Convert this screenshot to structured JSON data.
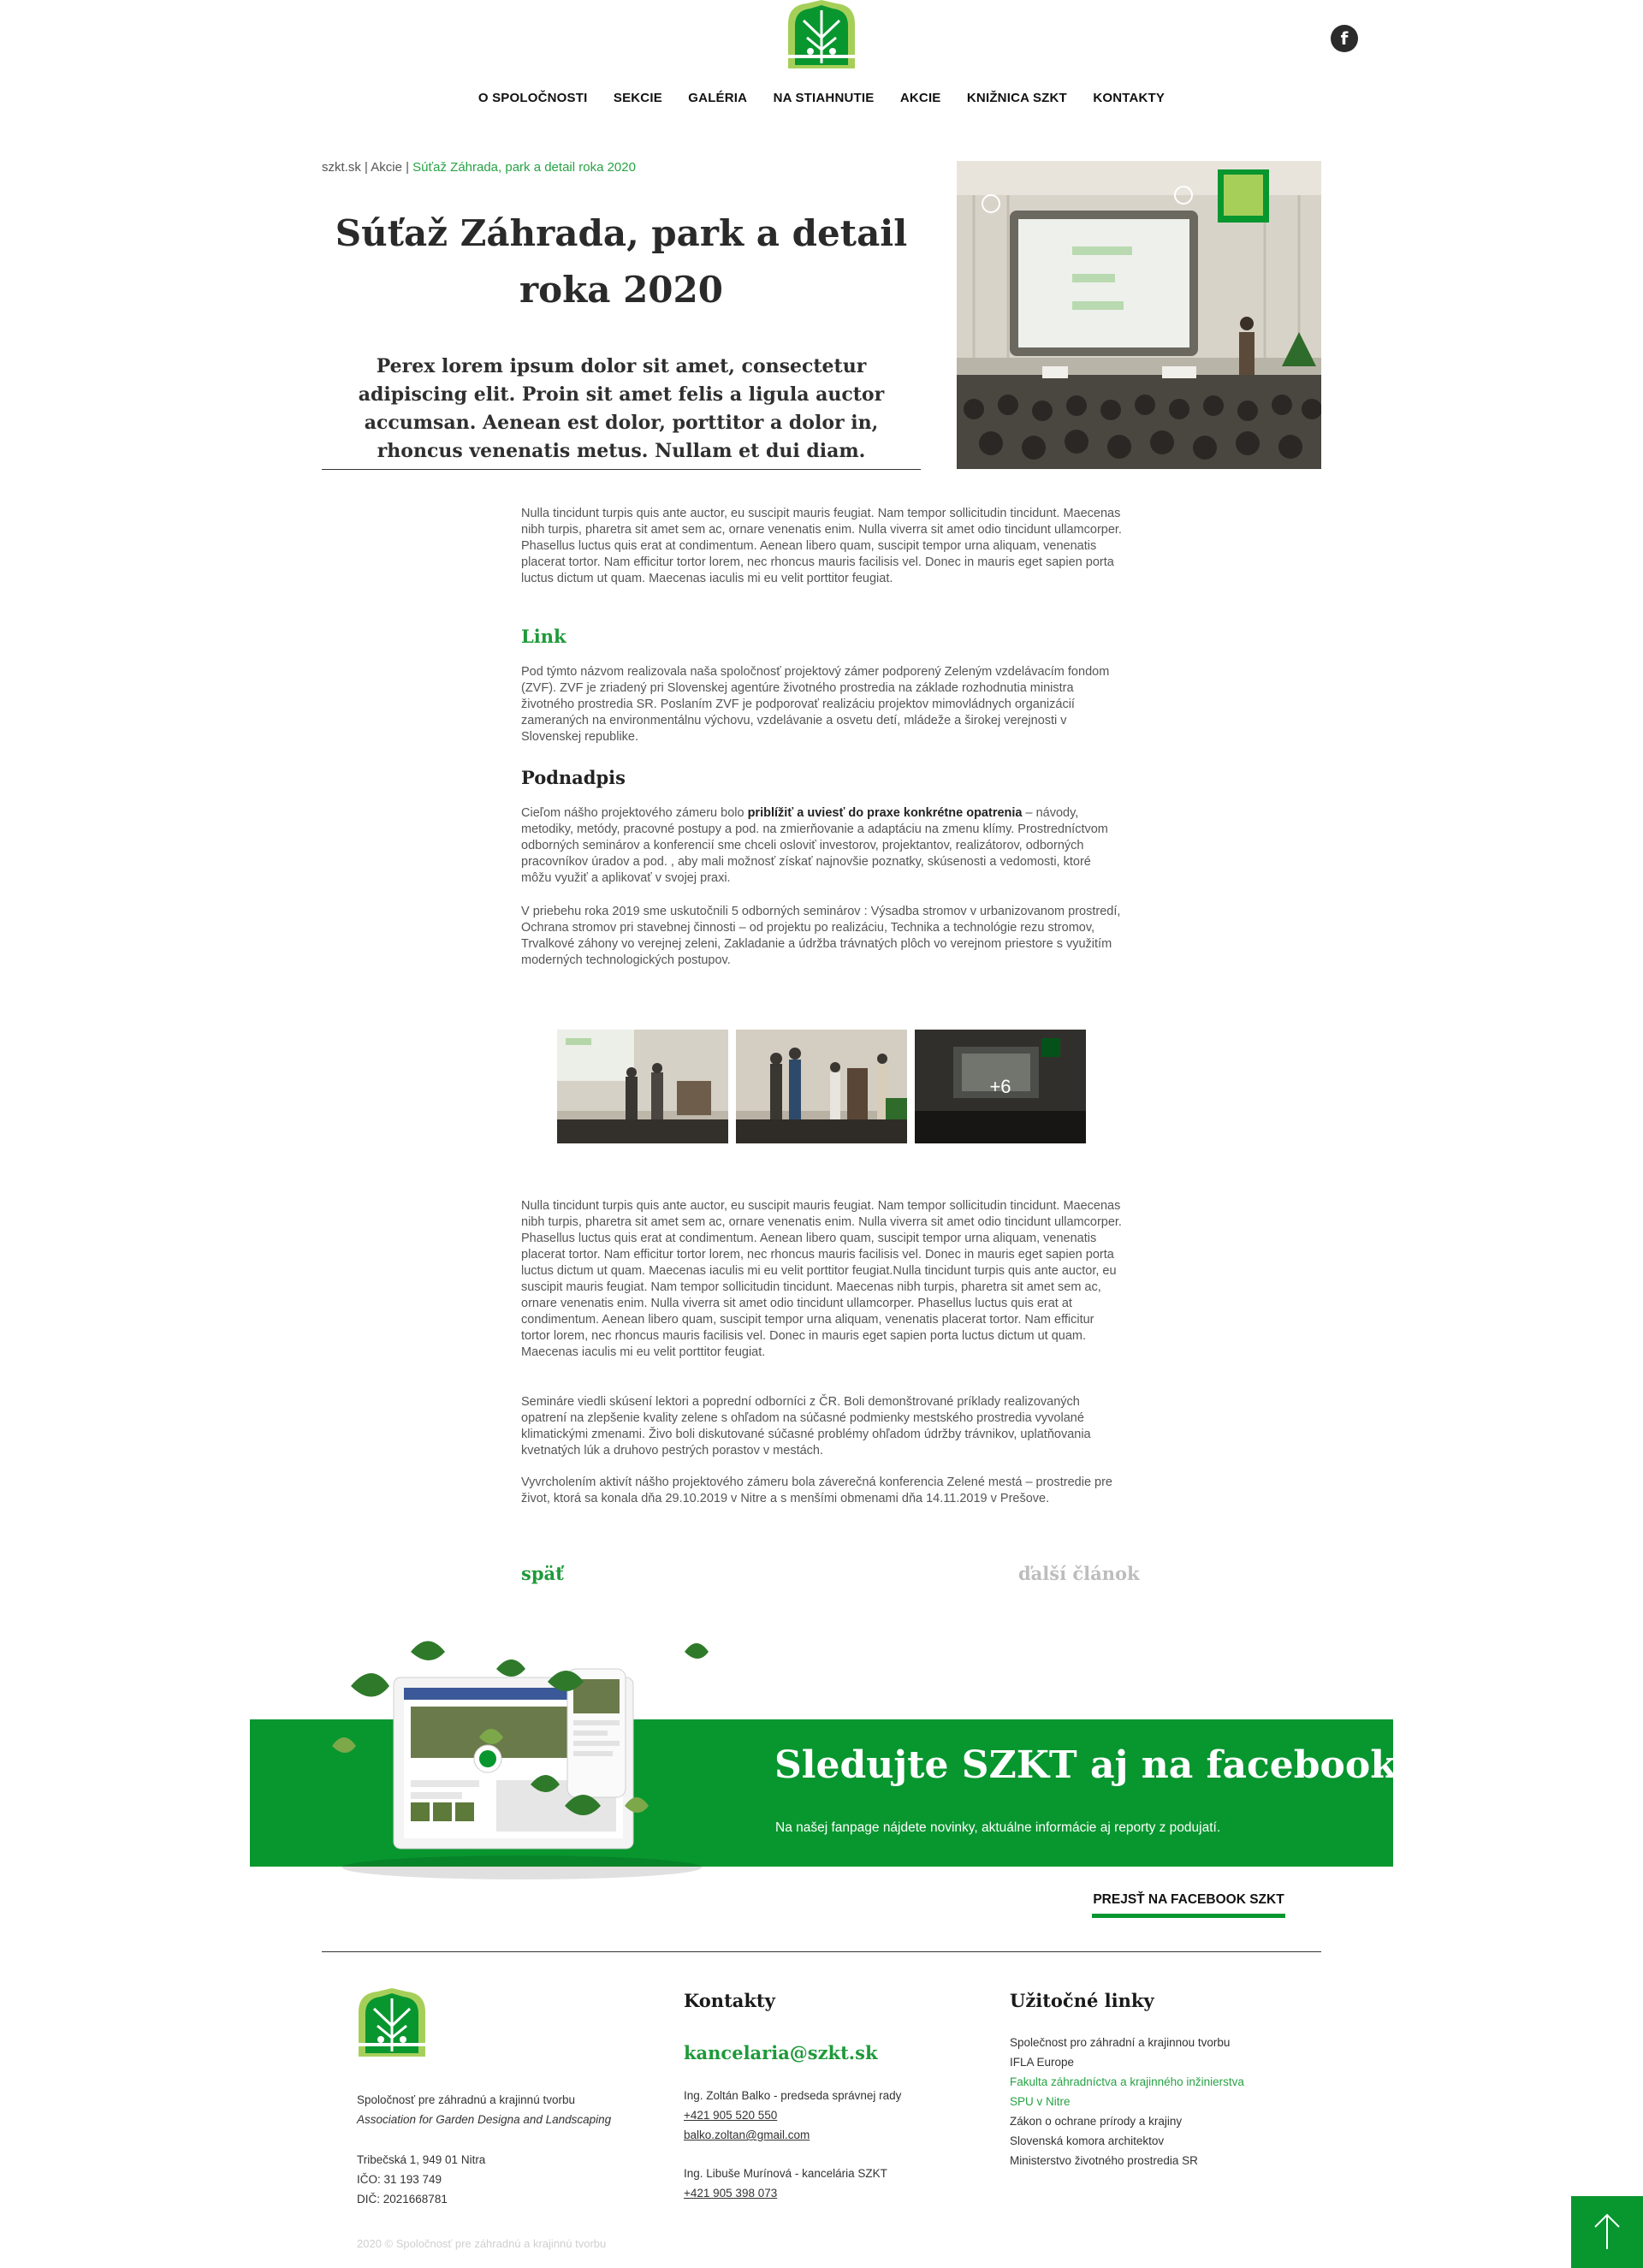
{
  "header": {
    "facebook_glyph": "f",
    "nav": [
      "O SPOLOČNOSTI",
      "SEKCIE",
      "GALÉRIA",
      "NA STIAHNUTIE",
      "AKCIE",
      "KNIŽNICA SZKT",
      "KONTAKTY"
    ]
  },
  "breadcrumb": {
    "home": "szkt.sk",
    "sep1": " | ",
    "section": "Akcie",
    "sep2": " | ",
    "current": "Súťaž Záhrada, park a detail roka 2020"
  },
  "article": {
    "title_line1": "Súťaž Záhrada, park a detail",
    "title_line2": "roka 2020",
    "perex": "Perex lorem ipsum dolor sit amet, consectetur adipiscing elit. Proin sit amet felis a ligula auctor accumsan. Aenean est dolor, porttitor a dolor in, rhoncus venenatis metus. Nullam et dui diam.",
    "p1": "Nulla tincidunt turpis quis ante auctor, eu suscipit mauris feugiat. Nam tempor sollicitudin tincidunt. Maecenas nibh turpis, pharetra sit amet sem ac, ornare venenatis enim. Nulla viverra sit amet odio tincidunt ullamcorper. Phasellus luctus quis erat at condimentum. Aenean libero quam, suscipit tempor urna aliquam, venenatis placerat tortor. Nam efficitur tortor lorem, nec rhoncus mauris facilisis vel. Donec in mauris eget sapien porta luctus dictum ut quam. Maecenas iaculis mi eu velit porttitor feugiat.",
    "link_heading": "Link",
    "p2": "Pod týmto názvom realizovala naša spoločnosť projektový zámer podporený Zeleným vzdelávacím fondom (ZVF). ZVF je zriadený pri Slovenskej agentúre životného prostredia na základe rozhodnutia ministra životného prostredia SR. Poslaním ZVF je podporovať realizáciu projektov mimovládnych organizácií zameraných na environmentálnu výchovu, vzdelávanie a osvetu detí, mládeže a širokej verejnosti v Slovenskej republike.",
    "subheading": "Podnadpis",
    "p3_before": "Cieľom nášho projektového zámeru bolo ",
    "p3_bold": "priblížiť a uviesť do praxe konkrétne opatrenia",
    "p3_after": " – návody, metodiky, metódy, pracovné postupy a pod. na zmierňovanie a adaptáciu na zmenu klímy. Prostredníctvom odborných seminárov a konferencií sme chceli osloviť investorov, projektantov, realizátorov, odborných pracovníkov úradov a pod. , aby mali možnosť získať najnovšie poznatky, skúsenosti a vedomosti, ktoré môžu využiť a aplikovať v svojej praxi.",
    "p4": "V priebehu roka 2019 sme uskutočnili 5 odborných seminárov : Výsadba stromov v urbanizovanom prostredí, Ochrana stromov pri stavebnej činnosti – od projektu po realizáciu, Technika a technológie rezu stromov, Trvalkové záhony vo verejnej zeleni, Zakladanie a údržba trávnatých plôch vo verejnom priestore s využitím moderných technologických postupov.",
    "gallery_more": "+6",
    "p5": "Nulla tincidunt turpis quis ante auctor, eu suscipit mauris feugiat. Nam tempor sollicitudin tincidunt. Maecenas nibh turpis, pharetra sit amet sem ac, ornare venenatis enim. Nulla viverra sit amet odio tincidunt ullamcorper. Phasellus luctus quis erat at condimentum. Aenean libero quam, suscipit tempor urna aliquam, venenatis placerat tortor. Nam efficitur tortor lorem, nec rhoncus mauris facilisis vel. Donec in mauris eget sapien porta luctus dictum ut quam. Maecenas iaculis mi eu velit porttitor feugiat.Nulla tincidunt turpis quis ante auctor, eu suscipit mauris feugiat. Nam tempor sollicitudin tincidunt. Maecenas nibh turpis, pharetra sit amet sem ac, ornare venenatis enim. Nulla viverra sit amet odio tincidunt ullamcorper. Phasellus luctus quis erat at condimentum. Aenean libero quam, suscipit tempor urna aliquam, venenatis placerat tortor. Nam efficitur tortor lorem, nec rhoncus mauris facilisis vel. Donec in mauris eget sapien porta luctus dictum ut quam. Maecenas iaculis mi eu velit porttitor feugiat.",
    "p6": "Semináre viedli skúsení lektori a poprední odborníci z ČR. Boli demonštrované príklady realizovaných opatrení na zlepšenie kvality zelene s ohľadom na súčasné podmienky mestského prostredia vyvolané klimatickými zmenami. Živo boli diskutované súčasné problémy ohľadom údržby trávnikov, uplatňovania kvetnatých lúk a druhovo pestrých porastov v mestách.",
    "p7": "Vyvrcholením aktivít nášho projektového zámeru bola záverečná konferencia Zelené mestá – prostredie pre život, ktorá sa konala dňa 29.10.2019 v Nitre a s menšími obmenami dňa 14.11.2019 v Prešove.",
    "back": "späť",
    "next": "ďalší článok"
  },
  "facebook_banner": {
    "heading": "Sledujte SZKT aj na facebooku",
    "subtext": "Na našej fanpage nájdete novinky, aktuálne informácie aj reporty z podujatí.",
    "button": "PREJSŤ NA FACEBOOK SZKT"
  },
  "footer": {
    "company_name": "Spoločnosť pre záhradnú a krajinnú tvorbu",
    "company_en": "Association for Garden Designa and Landscaping",
    "address": "Tribečská 1,  949 01 Nitra",
    "ico": "IČO: 31 193 749",
    "dic": "DIČ: 2021668781",
    "copyright": "2020 © Spoločnosť pre záhradnú a krajinnú tvorbu",
    "contacts_heading": "Kontakty",
    "email": "kancelaria@szkt.sk",
    "contact1_name": "Ing. Zoltán Balko - predseda správnej rady",
    "contact1_phone": "+421 905 520 550",
    "contact1_email": "balko.zoltan@gmail.com",
    "contact2_name": "Ing. Libuše Murínová - kancelária SZKT",
    "contact2_phone": "+421 905 398 073",
    "links_heading": "Užitočné linky",
    "links": [
      "Společnost pro záhradní a krajinnou tvorbu",
      "IFLA Europe",
      "Fakulta záhradníctva a krajinného inžinierstva",
      "SPU v Nitre",
      "Zákon o ochrane prírody a krajiny",
      "Slovenská komora architektov",
      "Ministerstvo životného prostredia SR"
    ]
  },
  "colors": {
    "brand_green": "#08962f",
    "link_green": "#27a244",
    "logo_light_green": "#a6cf5a"
  }
}
